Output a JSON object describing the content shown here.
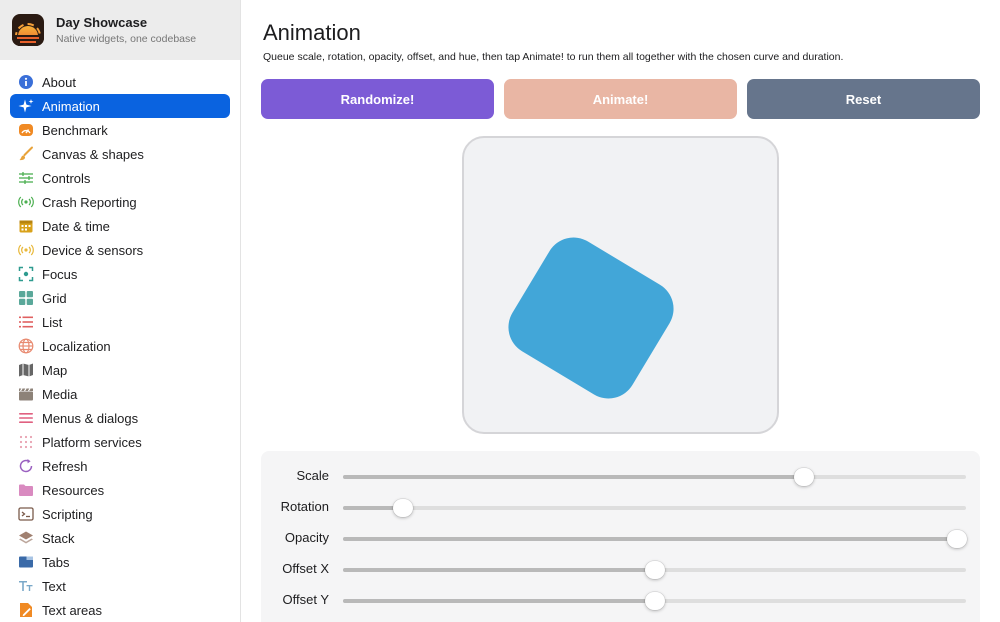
{
  "app": {
    "title": "Day Showcase",
    "subtitle": "Native widgets, one codebase"
  },
  "sidebar": {
    "items": [
      {
        "label": "About",
        "icon": "info-icon",
        "color": "#3a6fd8"
      },
      {
        "label": "Animation",
        "icon": "sparkles-icon",
        "color": "#ffffff",
        "active": true
      },
      {
        "label": "Benchmark",
        "icon": "gauge-icon",
        "color": "#f08a24"
      },
      {
        "label": "Canvas & shapes",
        "icon": "brush-icon",
        "color": "#e8a33a"
      },
      {
        "label": "Controls",
        "icon": "sliders-icon",
        "color": "#4caf50"
      },
      {
        "label": "Crash Reporting",
        "icon": "broadcast-icon",
        "color": "#4caf50"
      },
      {
        "label": "Date & time",
        "icon": "calendar-icon",
        "color": "#d9a21a"
      },
      {
        "label": "Device & sensors",
        "icon": "sensor-icon",
        "color": "#e8b83a"
      },
      {
        "label": "Focus",
        "icon": "focus-icon",
        "color": "#2e9b8f"
      },
      {
        "label": "Grid",
        "icon": "grid-icon",
        "color": "#5aa89a"
      },
      {
        "label": "List",
        "icon": "list-icon",
        "color": "#e06060"
      },
      {
        "label": "Localization",
        "icon": "globe-icon",
        "color": "#e88a70"
      },
      {
        "label": "Map",
        "icon": "map-icon",
        "color": "#666666"
      },
      {
        "label": "Media",
        "icon": "clapper-icon",
        "color": "#8d8278"
      },
      {
        "label": "Menus & dialogs",
        "icon": "menu-icon",
        "color": "#e06080"
      },
      {
        "label": "Platform services",
        "icon": "dots-grid-icon",
        "color": "#e8a0b0"
      },
      {
        "label": "Refresh",
        "icon": "refresh-icon",
        "color": "#9a60c0"
      },
      {
        "label": "Resources",
        "icon": "folder-icon",
        "color": "#d98ac0"
      },
      {
        "label": "Scripting",
        "icon": "terminal-icon",
        "color": "#7a5a4a"
      },
      {
        "label": "Stack",
        "icon": "stack-icon",
        "color": "#a08070"
      },
      {
        "label": "Tabs",
        "icon": "tabs-icon",
        "color": "#3a6aa8"
      },
      {
        "label": "Text",
        "icon": "text-icon",
        "color": "#7aa8c8"
      },
      {
        "label": "Text areas",
        "icon": "text-area-icon",
        "color": "#f08a24"
      }
    ]
  },
  "main": {
    "title": "Animation",
    "description": "Queue scale, rotation, opacity, offset, and hue, then tap Animate! to run them all together with the chosen curve and duration.",
    "buttons": {
      "randomize": {
        "label": "Randomize!",
        "color": "#7c5bd6"
      },
      "animate": {
        "label": "Animate!",
        "color": "#e9b6a4"
      },
      "reset": {
        "label": "Reset",
        "color": "#66758c"
      }
    },
    "shape_color": "#42a6d8",
    "sliders": [
      {
        "label": "Scale",
        "fraction": 0.74
      },
      {
        "label": "Rotation",
        "fraction": 0.096
      },
      {
        "label": "Opacity",
        "fraction": 0.985
      },
      {
        "label": "Offset X",
        "fraction": 0.5
      },
      {
        "label": "Offset Y",
        "fraction": 0.5
      }
    ]
  }
}
